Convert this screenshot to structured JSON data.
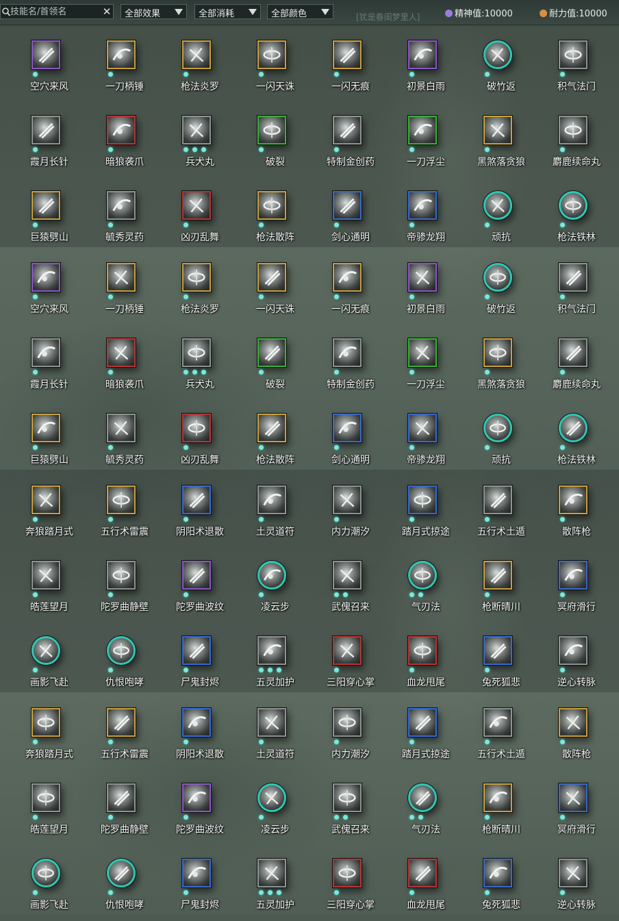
{
  "topbar": {
    "search_placeholder": "技能名/首领名",
    "clear_icon": "close-icon",
    "filters": [
      {
        "label": "全部效果"
      },
      {
        "label": "全部消耗"
      },
      {
        "label": "全部颜色"
      }
    ],
    "spirit": {
      "label": "精神值:10000",
      "color": "#9b7be0"
    },
    "endurance": {
      "label": "耐力值:10000",
      "color": "#d89040"
    },
    "faded_hint": "[犹是春闺梦里人]"
  },
  "colors": {
    "gold": "#c9a03c",
    "purple": "#8e56c9",
    "red": "#b83636",
    "green": "#3cae3a",
    "blue": "#3a6ad0",
    "gray": "#8d9492",
    "teal": "#2fc6b4",
    "dot": "#7fe6da"
  },
  "group_a": [
    [
      {
        "name": "空穴来风",
        "border": "purple",
        "round": false,
        "dots": 1,
        "icon": "wind-icon"
      },
      {
        "name": "一刀柄锤",
        "border": "gold",
        "round": false,
        "dots": 1,
        "icon": "blade-strike-icon"
      },
      {
        "name": "枪法炎罗",
        "border": "gold",
        "round": false,
        "dots": 1,
        "icon": "spear-icon"
      },
      {
        "name": "一闪天诛",
        "border": "gold",
        "round": false,
        "dots": 1,
        "icon": "flash-slash-icon"
      },
      {
        "name": "一闪无痕",
        "border": "gold",
        "round": false,
        "dots": 1,
        "icon": "flash-slash-icon"
      },
      {
        "name": "初景白雨",
        "border": "purple",
        "round": false,
        "dots": 1,
        "icon": "light-pillar-icon"
      },
      {
        "name": "破竹返",
        "border": "teal",
        "round": true,
        "dots": 1,
        "icon": "counter-icon"
      },
      {
        "name": "积气法门",
        "border": "gray",
        "round": false,
        "dots": 1,
        "icon": "qi-icon"
      }
    ],
    [
      {
        "name": "霞月长针",
        "border": "gray",
        "round": false,
        "dots": 1,
        "icon": "needle-icon"
      },
      {
        "name": "暗狼袭爪",
        "border": "red",
        "round": false,
        "dots": 1,
        "icon": "claw-icon"
      },
      {
        "name": "兵犬丸",
        "border": "gray",
        "round": false,
        "dots": 3,
        "icon": "pill-icon"
      },
      {
        "name": "破裂",
        "border": "green",
        "round": false,
        "dots": 1,
        "icon": "shatter-icon"
      },
      {
        "name": "特制金创药",
        "border": "gray",
        "round": false,
        "dots": 1,
        "icon": "potion-icon"
      },
      {
        "name": "一刀浮尘",
        "border": "green",
        "round": false,
        "dots": 1,
        "icon": "blade-strike-icon"
      },
      {
        "name": "黑煞落贪狼",
        "border": "gold",
        "round": false,
        "dots": 1,
        "icon": "wolf-icon"
      },
      {
        "name": "麝鹿续命丸",
        "border": "gray",
        "round": false,
        "dots": 1,
        "icon": "pill-icon"
      }
    ],
    [
      {
        "name": "巨猿劈山",
        "border": "gold",
        "round": false,
        "dots": 1,
        "icon": "ape-icon"
      },
      {
        "name": "毓秀灵药",
        "border": "gray",
        "round": false,
        "dots": 1,
        "icon": "gourd-icon"
      },
      {
        "name": "凶刃乱舞",
        "border": "red",
        "round": false,
        "dots": 1,
        "icon": "blade-dance-icon"
      },
      {
        "name": "枪法散阵",
        "border": "gold",
        "round": false,
        "dots": 1,
        "icon": "spear-icon"
      },
      {
        "name": "剑心通明",
        "border": "blue",
        "round": false,
        "dots": 1,
        "icon": "sword-icon"
      },
      {
        "name": "帝骖龙翔",
        "border": "blue",
        "round": false,
        "dots": 1,
        "icon": "dragon-icon"
      },
      {
        "name": "顽抗",
        "border": "teal",
        "round": true,
        "dots": 1,
        "icon": "resist-icon"
      },
      {
        "name": "枪法铁林",
        "border": "teal",
        "round": true,
        "dots": 1,
        "icon": "spear-icon"
      }
    ]
  ],
  "group_b": [
    [
      {
        "name": "奔狼踏月式",
        "border": "gold",
        "round": false,
        "dots": 1,
        "icon": "wolf-icon"
      },
      {
        "name": "五行术雷震",
        "border": "gold",
        "round": false,
        "dots": 1,
        "icon": "thunder-icon"
      },
      {
        "name": "阴阳术退散",
        "border": "blue",
        "round": false,
        "dots": 1,
        "icon": "yinyang-icon"
      },
      {
        "name": "土灵道符",
        "border": "gray",
        "round": false,
        "dots": 1,
        "icon": "talisman-icon"
      },
      {
        "name": "内力潮汐",
        "border": "gray",
        "round": false,
        "dots": 1,
        "icon": "tide-icon"
      },
      {
        "name": "踏月式掠途",
        "border": "blue",
        "round": false,
        "dots": 1,
        "icon": "moon-step-icon"
      },
      {
        "name": "五行术土遁",
        "border": "gray",
        "round": false,
        "dots": 1,
        "icon": "earth-icon"
      },
      {
        "name": "散阵枪",
        "border": "gold",
        "round": false,
        "dots": 1,
        "icon": "spear-icon"
      }
    ],
    [
      {
        "name": "皓莲望月",
        "border": "gray",
        "round": false,
        "dots": 1,
        "icon": "crescent-icon"
      },
      {
        "name": "陀罗曲静壁",
        "border": "gray",
        "round": false,
        "dots": 1,
        "icon": "wall-icon"
      },
      {
        "name": "陀罗曲波纹",
        "border": "purple",
        "round": false,
        "dots": 1,
        "icon": "ripple-icon"
      },
      {
        "name": "凌云步",
        "border": "teal",
        "round": true,
        "dots": 1,
        "icon": "cloud-step-icon"
      },
      {
        "name": "武傀召来",
        "border": "gray",
        "round": false,
        "dots": 2,
        "icon": "puppet-icon"
      },
      {
        "name": "气刃法",
        "border": "teal",
        "round": true,
        "dots": 2,
        "icon": "qi-blade-icon"
      },
      {
        "name": "枪断晴川",
        "border": "gold",
        "round": false,
        "dots": 1,
        "icon": "spear-icon"
      },
      {
        "name": "冥府滑行",
        "border": "blue",
        "round": false,
        "dots": 1,
        "icon": "glide-icon"
      }
    ],
    [
      {
        "name": "画影飞赴",
        "border": "teal",
        "round": true,
        "dots": 1,
        "icon": "shadow-dash-icon"
      },
      {
        "name": "仇恨咆哮",
        "border": "teal",
        "round": true,
        "dots": 1,
        "icon": "roar-icon"
      },
      {
        "name": "尸鬼封烬",
        "border": "blue",
        "round": false,
        "dots": 1,
        "icon": "ghost-fire-icon"
      },
      {
        "name": "五灵加护",
        "border": "gray",
        "round": false,
        "dots": 3,
        "icon": "guardian-icon"
      },
      {
        "name": "三阳穿心掌",
        "border": "red",
        "round": false,
        "dots": 1,
        "icon": "palm-icon"
      },
      {
        "name": "血龙甩尾",
        "border": "red",
        "round": false,
        "dots": 1,
        "icon": "dragon-tail-icon"
      },
      {
        "name": "兔死狐悲",
        "border": "blue",
        "round": false,
        "dots": 1,
        "icon": "fox-icon"
      },
      {
        "name": "逆心转脉",
        "border": "gray",
        "round": false,
        "dots": 1,
        "icon": "vein-icon"
      }
    ]
  ]
}
